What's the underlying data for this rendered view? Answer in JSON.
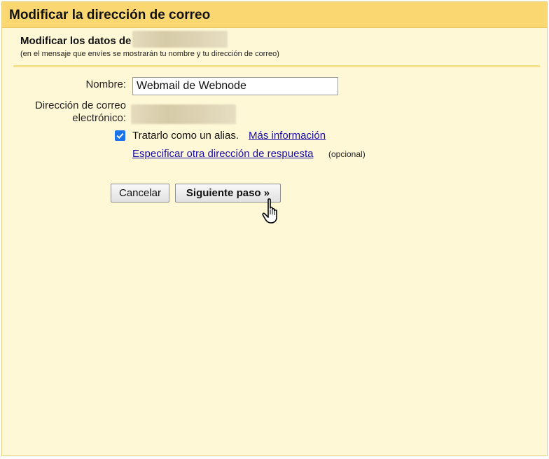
{
  "dialog": {
    "title": "Modificar la dirección de correo",
    "subhead": "Modificar los datos de",
    "note": "(en el mensaje que envíes se mostrarán tu nombre y tu dirección de correo)"
  },
  "form": {
    "name_label": "Nombre:",
    "name_value": "Webmail de Webnode",
    "address_label_line1": "Dirección de correo",
    "address_label_line2": "electrónico:",
    "alias_checked": true,
    "alias_text": "Tratarlo como un alias.",
    "more_info_link": "Más información",
    "reply_link": "Especificar otra dirección de respuesta",
    "optional_text": "(opcional)"
  },
  "buttons": {
    "cancel": "Cancelar",
    "next": "Siguiente paso »"
  },
  "colors": {
    "title_bar": "#fbd771",
    "panel_bg": "#fff8d6",
    "link": "#1a0dab",
    "checkbox": "#1a73e8"
  },
  "icons": {
    "checkbox": "checkmark-icon",
    "cursor": "hand-pointer-icon"
  }
}
